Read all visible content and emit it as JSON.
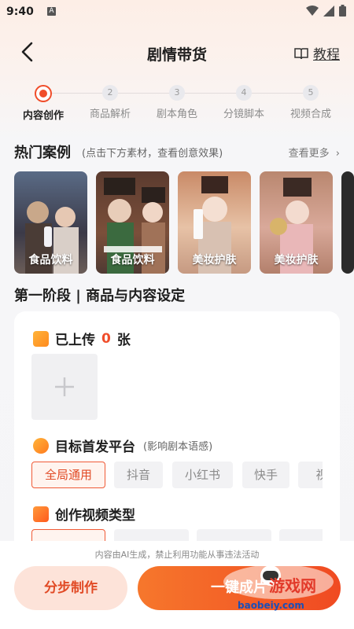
{
  "status_bar": {
    "time": "9:40",
    "notification_icon": "A"
  },
  "header": {
    "title": "剧情带货",
    "tutorial_label": "教程"
  },
  "steps": [
    {
      "num": "",
      "label": "内容创作",
      "active": true
    },
    {
      "num": "2",
      "label": "商品解析",
      "active": false
    },
    {
      "num": "3",
      "label": "剧本角色",
      "active": false
    },
    {
      "num": "4",
      "label": "分镜脚本",
      "active": false
    },
    {
      "num": "5",
      "label": "视频合成",
      "active": false
    }
  ],
  "hot_cases": {
    "title": "热门案例",
    "subtitle": "(点击下方素材，查看创意效果)",
    "more_label": "查看更多",
    "items": [
      {
        "caption": "食品饮料"
      },
      {
        "caption": "食品饮料"
      },
      {
        "caption": "美妆护肤"
      },
      {
        "caption": "美妆护肤"
      }
    ]
  },
  "stage": {
    "title": "第一阶段 | 商品与内容设定",
    "upload": {
      "prefix": "已上传",
      "count": "0",
      "suffix": "张"
    },
    "platform": {
      "label": "目标首发平台",
      "hint": "(影响剧本语感)",
      "options": [
        "全局通用",
        "抖音",
        "小红书",
        "快手",
        "视"
      ],
      "selected": "全局通用"
    },
    "video_type": {
      "label": "创作视频类型"
    }
  },
  "bottom": {
    "notice": "内容由AI生成，禁止利用功能从事违法活动",
    "step_button": "分步制作",
    "generate_button": "一键成片"
  },
  "watermark": {
    "text": "宝贝游戏网",
    "url": "baobeiy.com"
  },
  "colors": {
    "accent": "#f04d2a",
    "accent_light": "#fde3d9"
  }
}
